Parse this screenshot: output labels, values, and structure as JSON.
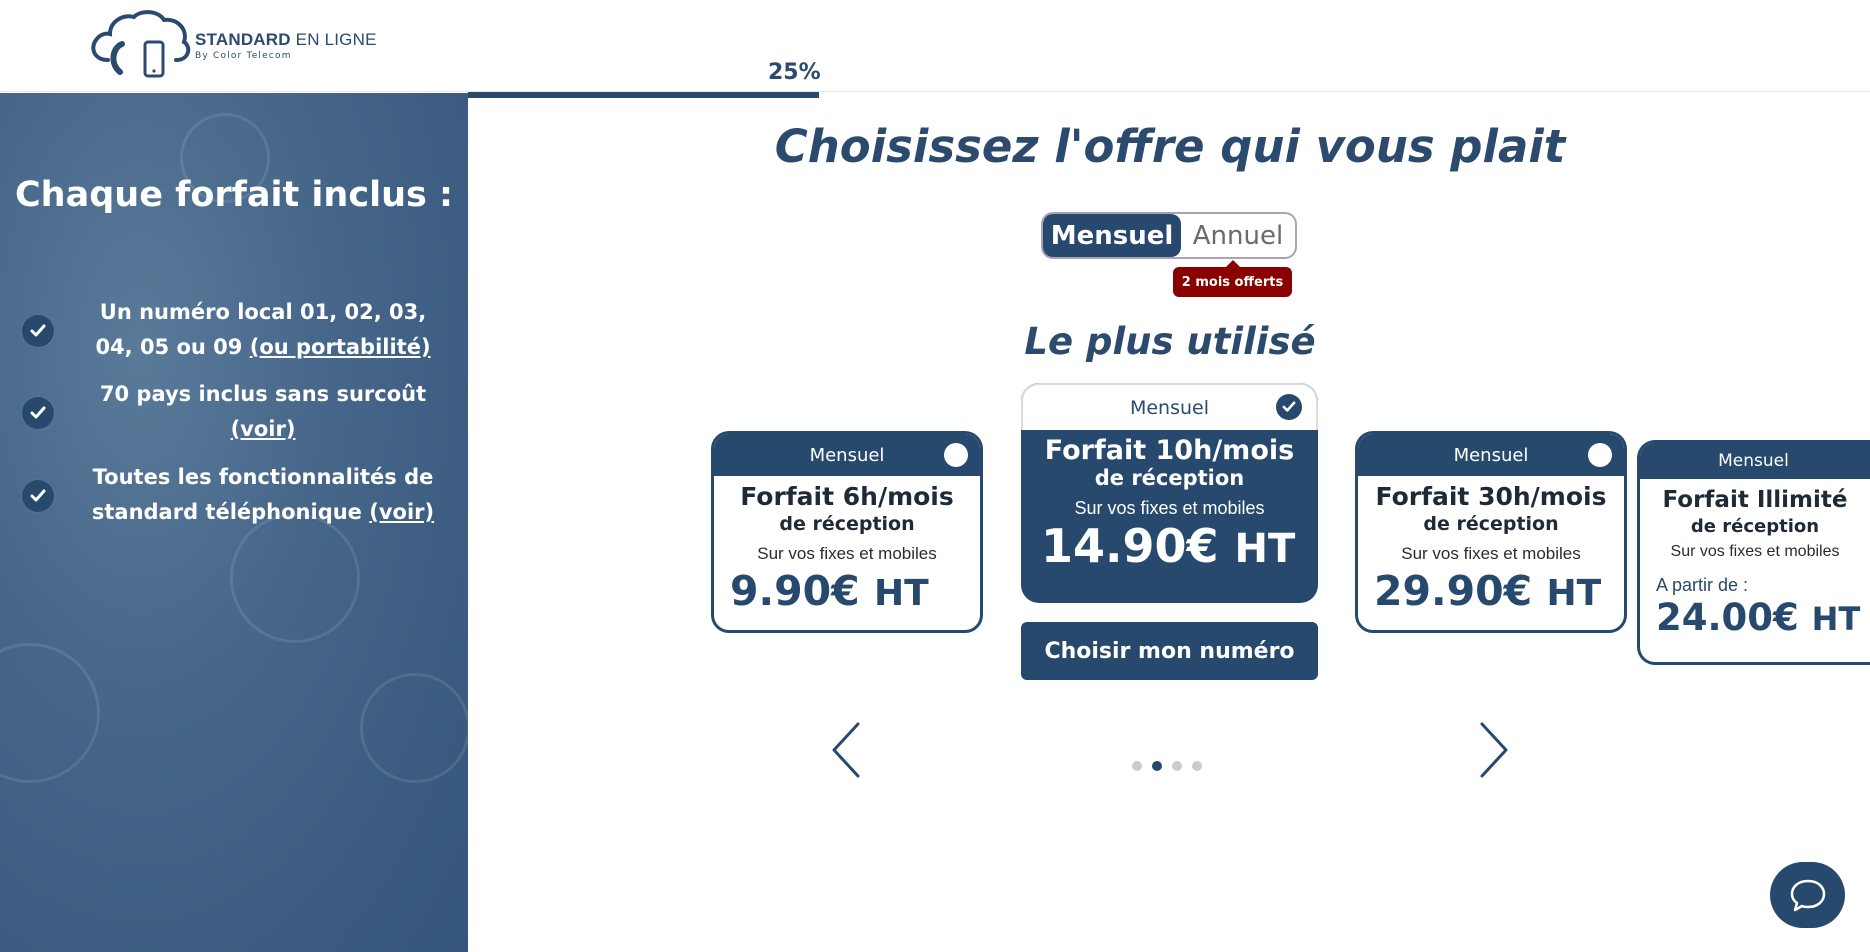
{
  "header": {
    "brand_bold": "STANDARD",
    "brand_light": " EN LIGNE",
    "brand_sub": "By Color Telecom",
    "progress_label": "25%",
    "progress_fraction": 0.25
  },
  "sidebar": {
    "title": "Chaque forfait inclus :",
    "perks": [
      {
        "text": "Un numéro local 01, 02, 03, 04, 05 ou 09 ",
        "link": "(ou portabilité)"
      },
      {
        "text": "70 pays inclus sans surcoût ",
        "link": "(voir)"
      },
      {
        "text": "Toutes les fonctionnalités de standard téléphonique ",
        "link": "(voir)"
      }
    ]
  },
  "main": {
    "title": "Choisissez l'offre qui vous plait",
    "toggle": {
      "monthly": "Mensuel",
      "yearly": "Annuel",
      "selected": "Mensuel"
    },
    "badge": "2 mois offerts",
    "subtitle": "Le plus utilisé",
    "choose_button": "Choisir mon numéro",
    "carousel": {
      "dots": 4,
      "active_dot": 2
    }
  },
  "plans": [
    {
      "head": "Mensuel",
      "name": "Forfait 6h/mois",
      "sub": "de réception",
      "note": "Sur vos fixes et mobiles",
      "price": "9.90€",
      "unit": "HT",
      "selected": false
    },
    {
      "head": "Mensuel",
      "name": "Forfait 10h/mois",
      "sub": "de réception",
      "note": "Sur vos fixes et mobiles",
      "price": "14.90€",
      "unit": "HT",
      "selected": true
    },
    {
      "head": "Mensuel",
      "name": "Forfait 30h/mois",
      "sub": "de réception",
      "note": "Sur vos fixes et mobiles",
      "price": "29.90€",
      "unit": "HT",
      "selected": false
    },
    {
      "head": "Mensuel",
      "name": "Forfait Illimité",
      "sub": "de réception",
      "note": "Sur vos fixes et mobiles",
      "from": "A partir de :",
      "price": "24.00€",
      "unit": "HT",
      "selected": false
    }
  ],
  "colors": {
    "primary": "#27496d",
    "badge": "#8b0000",
    "sidebar": "#46678a"
  },
  "icons": [
    "cloud-phone-logo-icon",
    "check-icon",
    "chevron-left-icon",
    "chevron-right-icon",
    "chat-bubble-icon"
  ]
}
